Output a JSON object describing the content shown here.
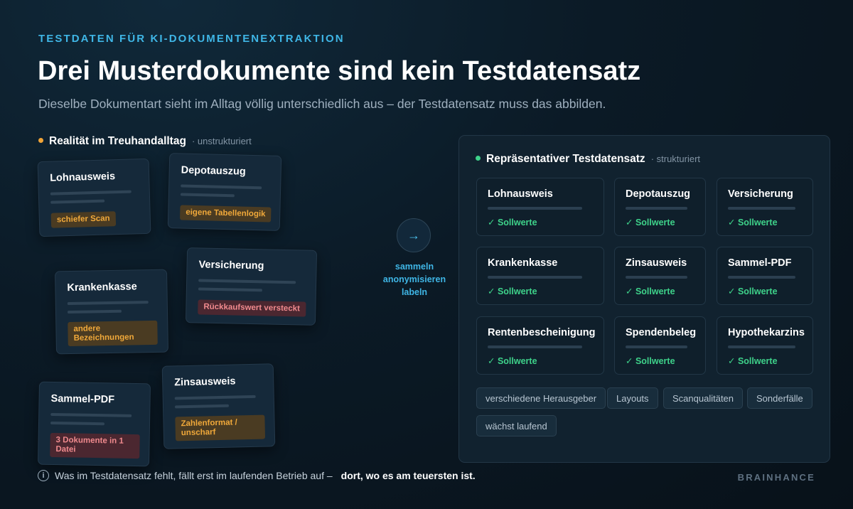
{
  "header": {
    "eyebrow": "TESTDATEN FÜR KI-DOKUMENTENEXTRAKTION",
    "title": "Drei Musterdokumente sind kein Testdatensatz",
    "subtitle": "Dieselbe Dokumentart sieht im Alltag völlig unterschiedlich aus – der Testdatensatz muss das abbilden."
  },
  "colors": {
    "accent": "#3fb6e6",
    "warning_dot": "#f0a437",
    "success": "#3ed28a",
    "tag_orange": "#f1a93a",
    "tag_red": "#f08a8e"
  },
  "reality": {
    "heading": "Realität im Treuhandalltag",
    "sub": "· unstrukturiert",
    "cards": [
      {
        "title": "Lohnausweis",
        "tag": "schiefer Scan",
        "tag_style": "orange"
      },
      {
        "title": "Depotauszug",
        "tag": "eigene Tabellenlogik",
        "tag_style": "orange"
      },
      {
        "title": "Versicherung",
        "tag": "Rückkaufswert versteckt",
        "tag_style": "red"
      },
      {
        "title": "Krankenkasse",
        "tag": "andere Bezeichnungen",
        "tag_style": "orange"
      },
      {
        "title": "Zinsausweis",
        "tag": "Zahlenformat / unscharf",
        "tag_style": "orange"
      },
      {
        "title": "Sammel-PDF",
        "tag": "3 Dokumente in 1 Datei",
        "tag_style": "red"
      }
    ]
  },
  "flow": {
    "arrow_icon": "arrow-right-icon",
    "arrow_glyph": "→",
    "label_lines": [
      "sammeln",
      "anonymisieren",
      "labeln"
    ]
  },
  "dataset": {
    "heading": "Repräsentativer Testdatensatz",
    "sub": "· strukturiert",
    "check_label": "✓ Sollwerte",
    "cards": [
      "Lohnausweis",
      "Depotauszug",
      "Versicherung",
      "Krankenkasse",
      "Zinsausweis",
      "Sammel-PDF",
      "Rentenbescheinigung",
      "Spendenbeleg",
      "Hypothekarzins"
    ],
    "chips": [
      "verschiedene Herausgeber",
      "Layouts",
      "Scanqualitäten",
      "Sonderfälle",
      "wächst laufend"
    ]
  },
  "footer": {
    "info_icon": "info-icon",
    "text": "Was im Testdatensatz fehlt, fällt erst im laufenden Betrieb auf –",
    "emphasis": "dort, wo es am teuersten ist.",
    "brand": "BRAINHANCE"
  }
}
